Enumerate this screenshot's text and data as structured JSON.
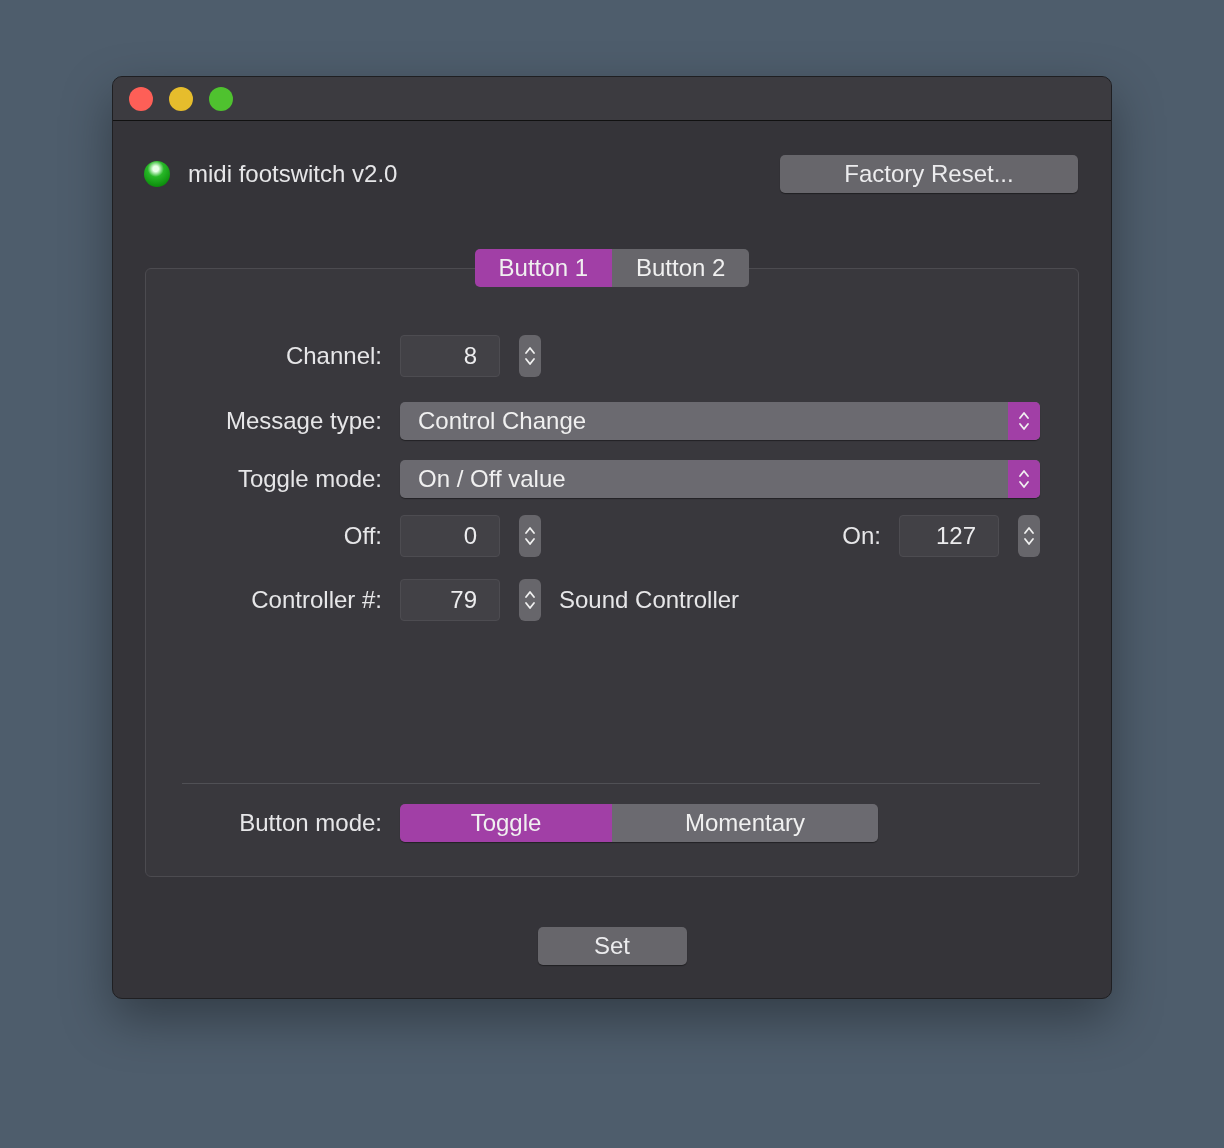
{
  "header": {
    "device_connected": true,
    "title": "midi footswitch v2.0",
    "reset_button": "Factory Reset..."
  },
  "tabs": [
    {
      "label": "Button 1",
      "selected": true
    },
    {
      "label": "Button 2",
      "selected": false
    }
  ],
  "channel": {
    "label": "Channel:",
    "value": "8"
  },
  "message_type": {
    "label": "Message type:",
    "value": "Control Change"
  },
  "toggle_mode": {
    "label": "Toggle mode:",
    "value": "On / Off value"
  },
  "off": {
    "label": "Off:",
    "value": "0"
  },
  "on": {
    "label": "On:",
    "value": "127"
  },
  "controller": {
    "label": "Controller #:",
    "value": "79",
    "description": "Sound Controller"
  },
  "button_mode": {
    "label": "Button mode:",
    "options": [
      {
        "label": "Toggle",
        "selected": true
      },
      {
        "label": "Momentary",
        "selected": false
      }
    ]
  },
  "set_button": "Set"
}
